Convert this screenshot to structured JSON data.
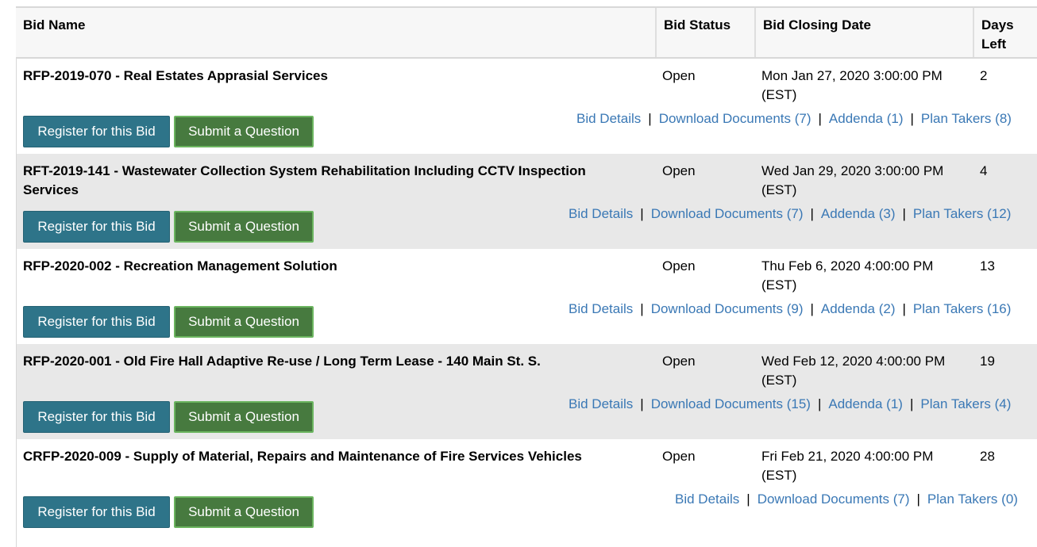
{
  "table": {
    "headers": {
      "bid_name": "Bid Name",
      "bid_status": "Bid Status",
      "closing_date": "Bid Closing Date",
      "days_left_1": "Days",
      "days_left_2": "Left"
    },
    "rows": [
      {
        "name": "RFP-2019-070 - Real Estates Apprasial Services",
        "status": "Open",
        "closing_1": "Mon Jan 27, 2020 3:00:00 PM",
        "closing_2": "(EST)",
        "days": "2",
        "register": "Register for this Bid",
        "question": "Submit a Question",
        "details": "Bid Details",
        "documents": "Download Documents (7)",
        "addenda": "Addenda (1)",
        "plan_takers": "Plan Takers (8)"
      },
      {
        "name": "RFT-2019-141 - Wastewater Collection System Rehabilitation Including CCTV Inspection Services",
        "status": "Open",
        "closing_1": "Wed Jan 29, 2020 3:00:00 PM",
        "closing_2": "(EST)",
        "days": "4",
        "register": "Register for this Bid",
        "question": "Submit a Question",
        "details": "Bid Details",
        "documents": "Download Documents (7)",
        "addenda": "Addenda (3)",
        "plan_takers": "Plan Takers (12)"
      },
      {
        "name": "RFP-2020-002 - Recreation Management Solution",
        "status": "Open",
        "closing_1": "Thu Feb 6, 2020 4:00:00 PM",
        "closing_2": "(EST)",
        "days": "13",
        "register": "Register for this Bid",
        "question": "Submit a Question",
        "details": "Bid Details",
        "documents": "Download Documents (9)",
        "addenda": "Addenda (2)",
        "plan_takers": "Plan Takers (16)"
      },
      {
        "name": "RFP-2020-001 - Old Fire Hall Adaptive Re-use / Long Term Lease - 140 Main St. S.",
        "status": "Open",
        "closing_1": "Wed Feb 12, 2020 4:00:00 PM",
        "closing_2": "(EST)",
        "days": "19",
        "register": "Register for this Bid",
        "question": "Submit a Question",
        "details": "Bid Details",
        "documents": "Download Documents (15)",
        "addenda": "Addenda (1)",
        "plan_takers": "Plan Takers (4)"
      },
      {
        "name": "CRFP-2020-009 - Supply of Material, Repairs and Maintenance of Fire Services Vehicles",
        "status": "Open",
        "closing_1": "Fri Feb 21, 2020 4:00:00 PM",
        "closing_2": "(EST)",
        "days": "28",
        "register": "Register for this Bid",
        "question": "Submit a Question",
        "details": "Bid Details",
        "documents": "Download Documents (7)",
        "plan_takers": "Plan Takers (0)"
      }
    ]
  },
  "colors": {
    "register_button": "#2e7489",
    "question_button": "#477a3f",
    "link": "#3a78b5",
    "shaded_row": "#e8e8e8"
  }
}
